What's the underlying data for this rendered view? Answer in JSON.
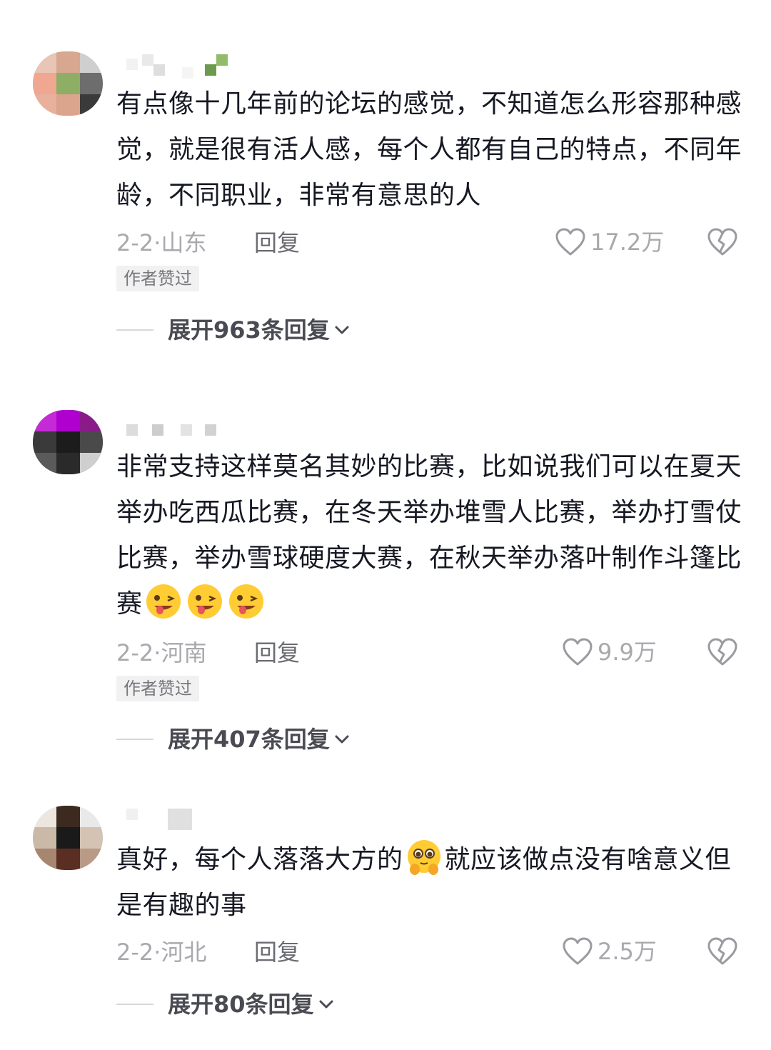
{
  "comments": [
    {
      "text": "有点像十几年前的论坛的感觉，不知道怎么形容那种感觉，就是很有活人感，每个人都有自己的特点，不同年龄，不同职业，非常有意思的人",
      "date": "2-2",
      "location": "山东",
      "meta_sep": "·",
      "reply_label": "回复",
      "likes": "17.2万",
      "author_badge": "作者赞过",
      "expand_label": "展开963条回复"
    },
    {
      "text": "非常支持这样莫名其妙的比赛，比如说我们可以在夏天举办吃西瓜比赛，在冬天举办堆雪人比赛，举办打雪仗比赛，举办雪球硬度大赛，在秋天举办落叶制作斗篷比赛",
      "emoji_name": "wink-tongue-emoji",
      "date": "2-2",
      "location": "河南",
      "meta_sep": "·",
      "reply_label": "回复",
      "likes": "9.9万",
      "author_badge": "作者赞过",
      "expand_label": "展开407条回复"
    },
    {
      "text_before": "真好，每个人落落大方的",
      "emoji_name": "shy-pleading-emoji",
      "text_after": "就应该做点没有啥意义但是有趣的事",
      "date": "2-2",
      "location": "河北",
      "meta_sep": "·",
      "reply_label": "回复",
      "likes": "2.5万",
      "expand_label": "展开80条回复"
    }
  ],
  "colors": {
    "text": "#161823",
    "meta": "#a8a9ad",
    "badge_bg": "#f1f1f2",
    "expand": "#4a4b52"
  }
}
